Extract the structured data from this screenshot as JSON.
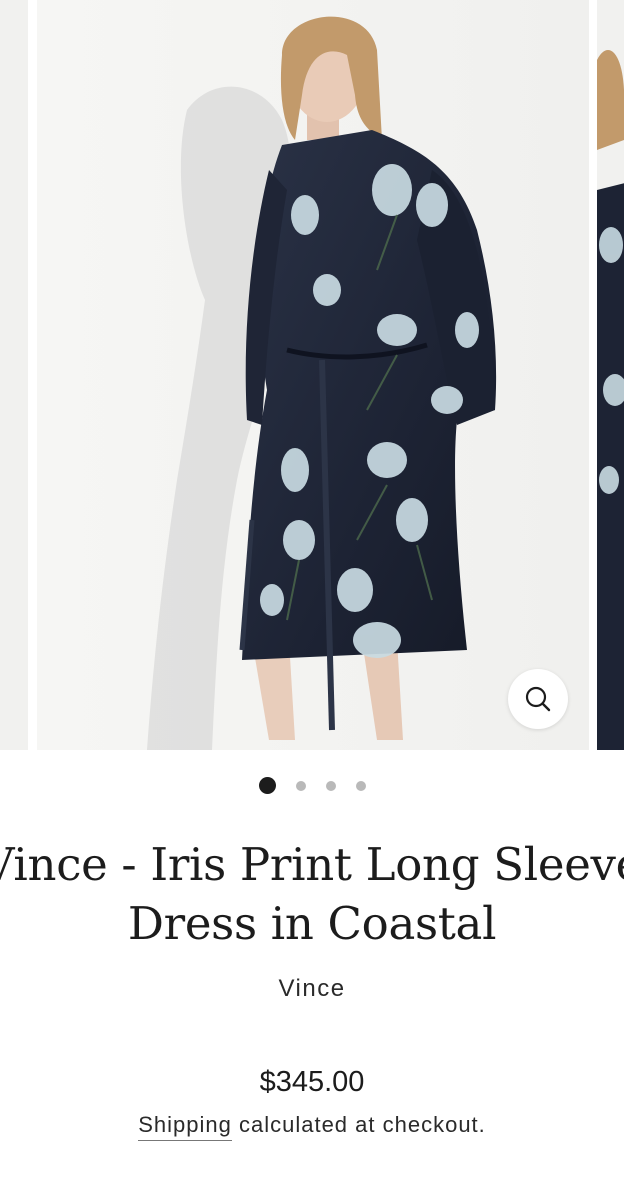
{
  "gallery": {
    "active_index": 0,
    "dot_count": 4,
    "zoom_icon": "search-icon",
    "accent_active_dot": "#1c1c1c",
    "inactive_dot": "#b9b9b9"
  },
  "product": {
    "title_line1": "Vince - Iris Print Long Sleeve",
    "title_line2": "Dress in Coastal",
    "vendor": "Vince",
    "price": "$345.00",
    "shipping_link": "Shipping",
    "shipping_rest": " calculated at checkout."
  }
}
